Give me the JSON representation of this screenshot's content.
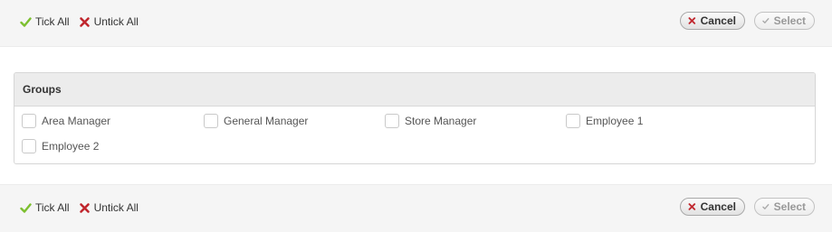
{
  "toolbar": {
    "tick_all": "Tick All",
    "untick_all": "Untick All",
    "cancel": "Cancel",
    "select": "Select"
  },
  "groups": {
    "title": "Groups",
    "options": [
      "Area Manager",
      "General Manager",
      "Store Manager",
      "Employee 1",
      "Employee 2"
    ]
  },
  "colors": {
    "tick_green": "#7cbf2f",
    "cross_red": "#c0262d",
    "bar_bg": "#f5f5f5",
    "panel_head_bg": "#ececec"
  }
}
